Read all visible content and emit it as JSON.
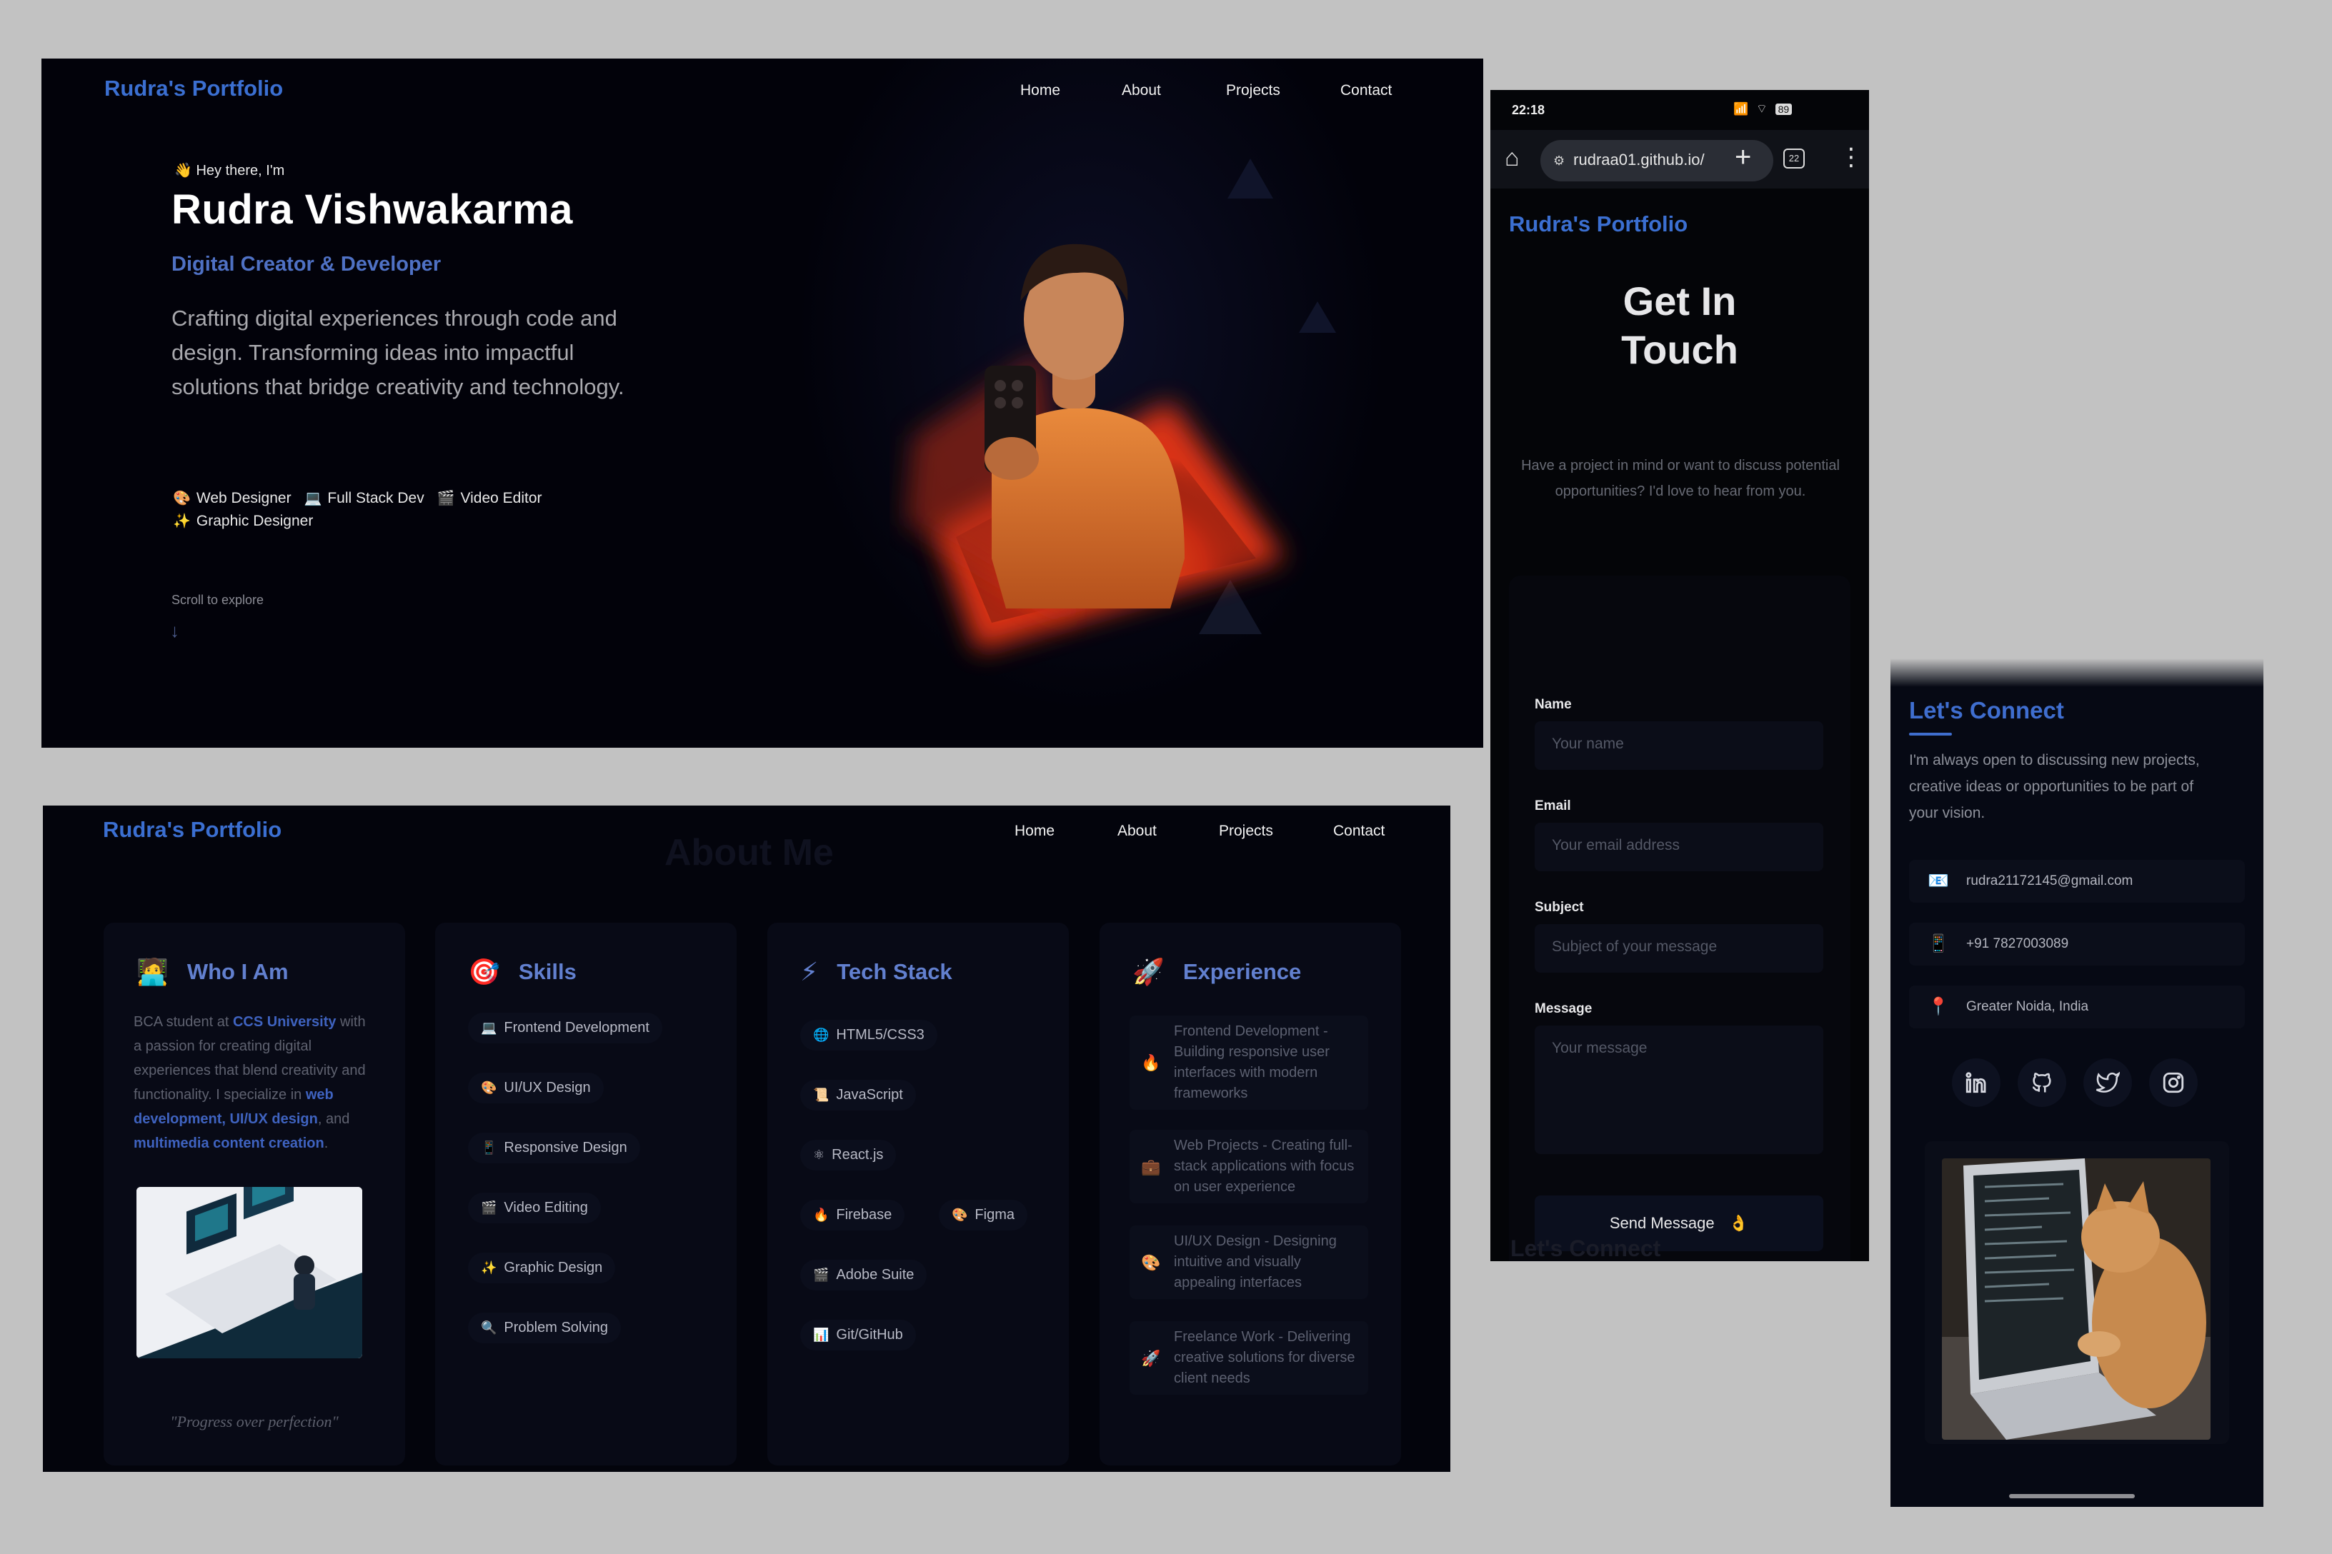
{
  "hero": {
    "logo": "Rudra's Portfolio",
    "nav": [
      "Home",
      "About",
      "Projects",
      "Contact"
    ],
    "greeting": "Hey there, I'm",
    "greeting_icon": "waving-hand-icon",
    "name": "Rudra Vishwakarma",
    "role": "Digital Creator & Developer",
    "description": "Crafting digital experiences through code and design. Transforming ideas into impactful solutions that bridge creativity and technology.",
    "tags": [
      {
        "icon": "palette-icon",
        "label": "Web Designer"
      },
      {
        "icon": "laptop-icon",
        "label": "Full Stack Dev"
      },
      {
        "icon": "clapper-icon",
        "label": "Video Editor"
      },
      {
        "icon": "sparkles-icon",
        "label": "Graphic Designer"
      }
    ],
    "scroll_hint": "Scroll to explore",
    "scroll_arrow": "↓"
  },
  "about": {
    "logo": "Rudra's Portfolio",
    "nav": [
      "Home",
      "About",
      "Projects",
      "Contact"
    ],
    "section_title": "About Me",
    "who": {
      "title": "Who I Am",
      "icon": "person-icon",
      "text_1": "BCA student at ",
      "text_uni": "CCS University",
      "text_2": " with a passion for creating digital experiences that blend creativity and functionality. I specialize in ",
      "text_web": "web development",
      "text_sep1": ", ",
      "text_ui": "UI/UX design",
      "text_sep2": ", and ",
      "text_mm": "multimedia content creation",
      "text_end": ".",
      "quote": "\"Progress over perfection\""
    },
    "skills": {
      "title": "Skills",
      "icon": "target-icon",
      "items": [
        {
          "icon": "laptop-icon",
          "label": "Frontend Development"
        },
        {
          "icon": "palette-icon",
          "label": "UI/UX Design"
        },
        {
          "icon": "phone-icon",
          "label": "Responsive Design"
        },
        {
          "icon": "clapper-icon",
          "label": "Video Editing"
        },
        {
          "icon": "sparkles-icon",
          "label": "Graphic Design"
        },
        {
          "icon": "magnifier-icon",
          "label": "Problem Solving"
        }
      ]
    },
    "tech": {
      "title": "Tech Stack",
      "icon": "lightning-icon",
      "items": [
        {
          "icon": "globe-icon",
          "label": "HTML5/CSS3"
        },
        {
          "icon": "scroll-icon",
          "label": "JavaScript"
        },
        {
          "icon": "atom-icon",
          "label": "React.js"
        },
        {
          "icon": "fire-icon",
          "label": "Firebase"
        },
        {
          "icon": "palette-icon",
          "label": "Figma"
        },
        {
          "icon": "clapper-icon",
          "label": "Adobe Suite"
        },
        {
          "icon": "chart-icon",
          "label": "Git/GitHub"
        }
      ]
    },
    "experience": {
      "title": "Experience",
      "icon": "rocket-icon",
      "items": [
        {
          "icon": "fire-icon",
          "label": "Frontend Development - Building responsive user interfaces with modern frameworks"
        },
        {
          "icon": "briefcase-icon",
          "label": "Web Projects - Creating full-stack applications with focus on user experience"
        },
        {
          "icon": "palette-icon",
          "label": "UI/UX Design - Designing intuitive and visually appealing interfaces"
        },
        {
          "icon": "rocket-icon",
          "label": "Freelance Work - Delivering creative solutions for diverse client needs"
        }
      ]
    }
  },
  "phone": {
    "time": "22:18",
    "status_icons": "VoLTE wifi call signal",
    "battery": "89",
    "url": "rudraa01.github.io/",
    "tab_count": "22",
    "logo": "Rudra's Portfolio",
    "heading_line1": "Get In",
    "heading_line2": "Touch",
    "intro": "Have a project in mind or want to discuss potential opportunities? I'd love to hear from you.",
    "form": {
      "name_label": "Name",
      "name_placeholder": "Your name",
      "email_label": "Email",
      "email_placeholder": "Your email address",
      "subject_label": "Subject",
      "subject_placeholder": "Subject of your message",
      "message_label": "Message",
      "message_placeholder": "Your message",
      "submit": "Send Message"
    },
    "next_section": "Let's Connect"
  },
  "connect": {
    "title": "Let's Connect",
    "text": "I'm always open to discussing new projects, creative ideas or opportunities to be part of your vision.",
    "contacts": [
      {
        "icon": "envelope-icon",
        "value": "rudra21172145@gmail.com"
      },
      {
        "icon": "mobile-phone-icon",
        "value": "+91 7827003089"
      },
      {
        "icon": "location-pin-icon",
        "value": "Greater Noida, India"
      }
    ],
    "socials": [
      "linkedin-icon",
      "github-icon",
      "twitter-icon",
      "instagram-icon"
    ]
  }
}
